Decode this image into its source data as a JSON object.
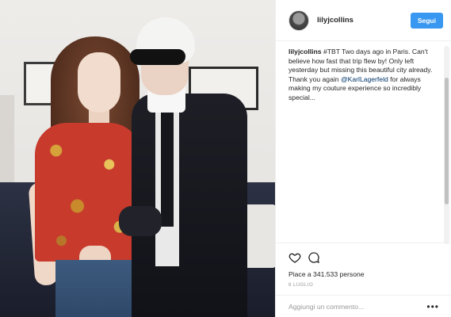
{
  "post": {
    "username": "lilyjcollins",
    "follow_label": "Segui",
    "caption": {
      "user": "lilyjcollins",
      "text_before": " #TBT Two days ago in Paris. Can't believe how fast that trip flew by! Only left yesterday but missing this beautiful city already. Thank you again ",
      "mention": "@KarlLagerfeld",
      "text_after": " for always making my couture experience so incredibly special..."
    },
    "likes": "Piace a 341.533 persone",
    "date": "6 LUGLIO",
    "comment_placeholder": "Aggiungi un commento...",
    "more_label": "•••"
  },
  "icons": {
    "like": "heart-icon",
    "comment": "comment-bubble-icon",
    "options": "more-options-icon",
    "avatar": "profile-avatar"
  },
  "colors": {
    "follow_button": "#3897f0",
    "mention": "#003569",
    "muted_text": "#999999"
  }
}
